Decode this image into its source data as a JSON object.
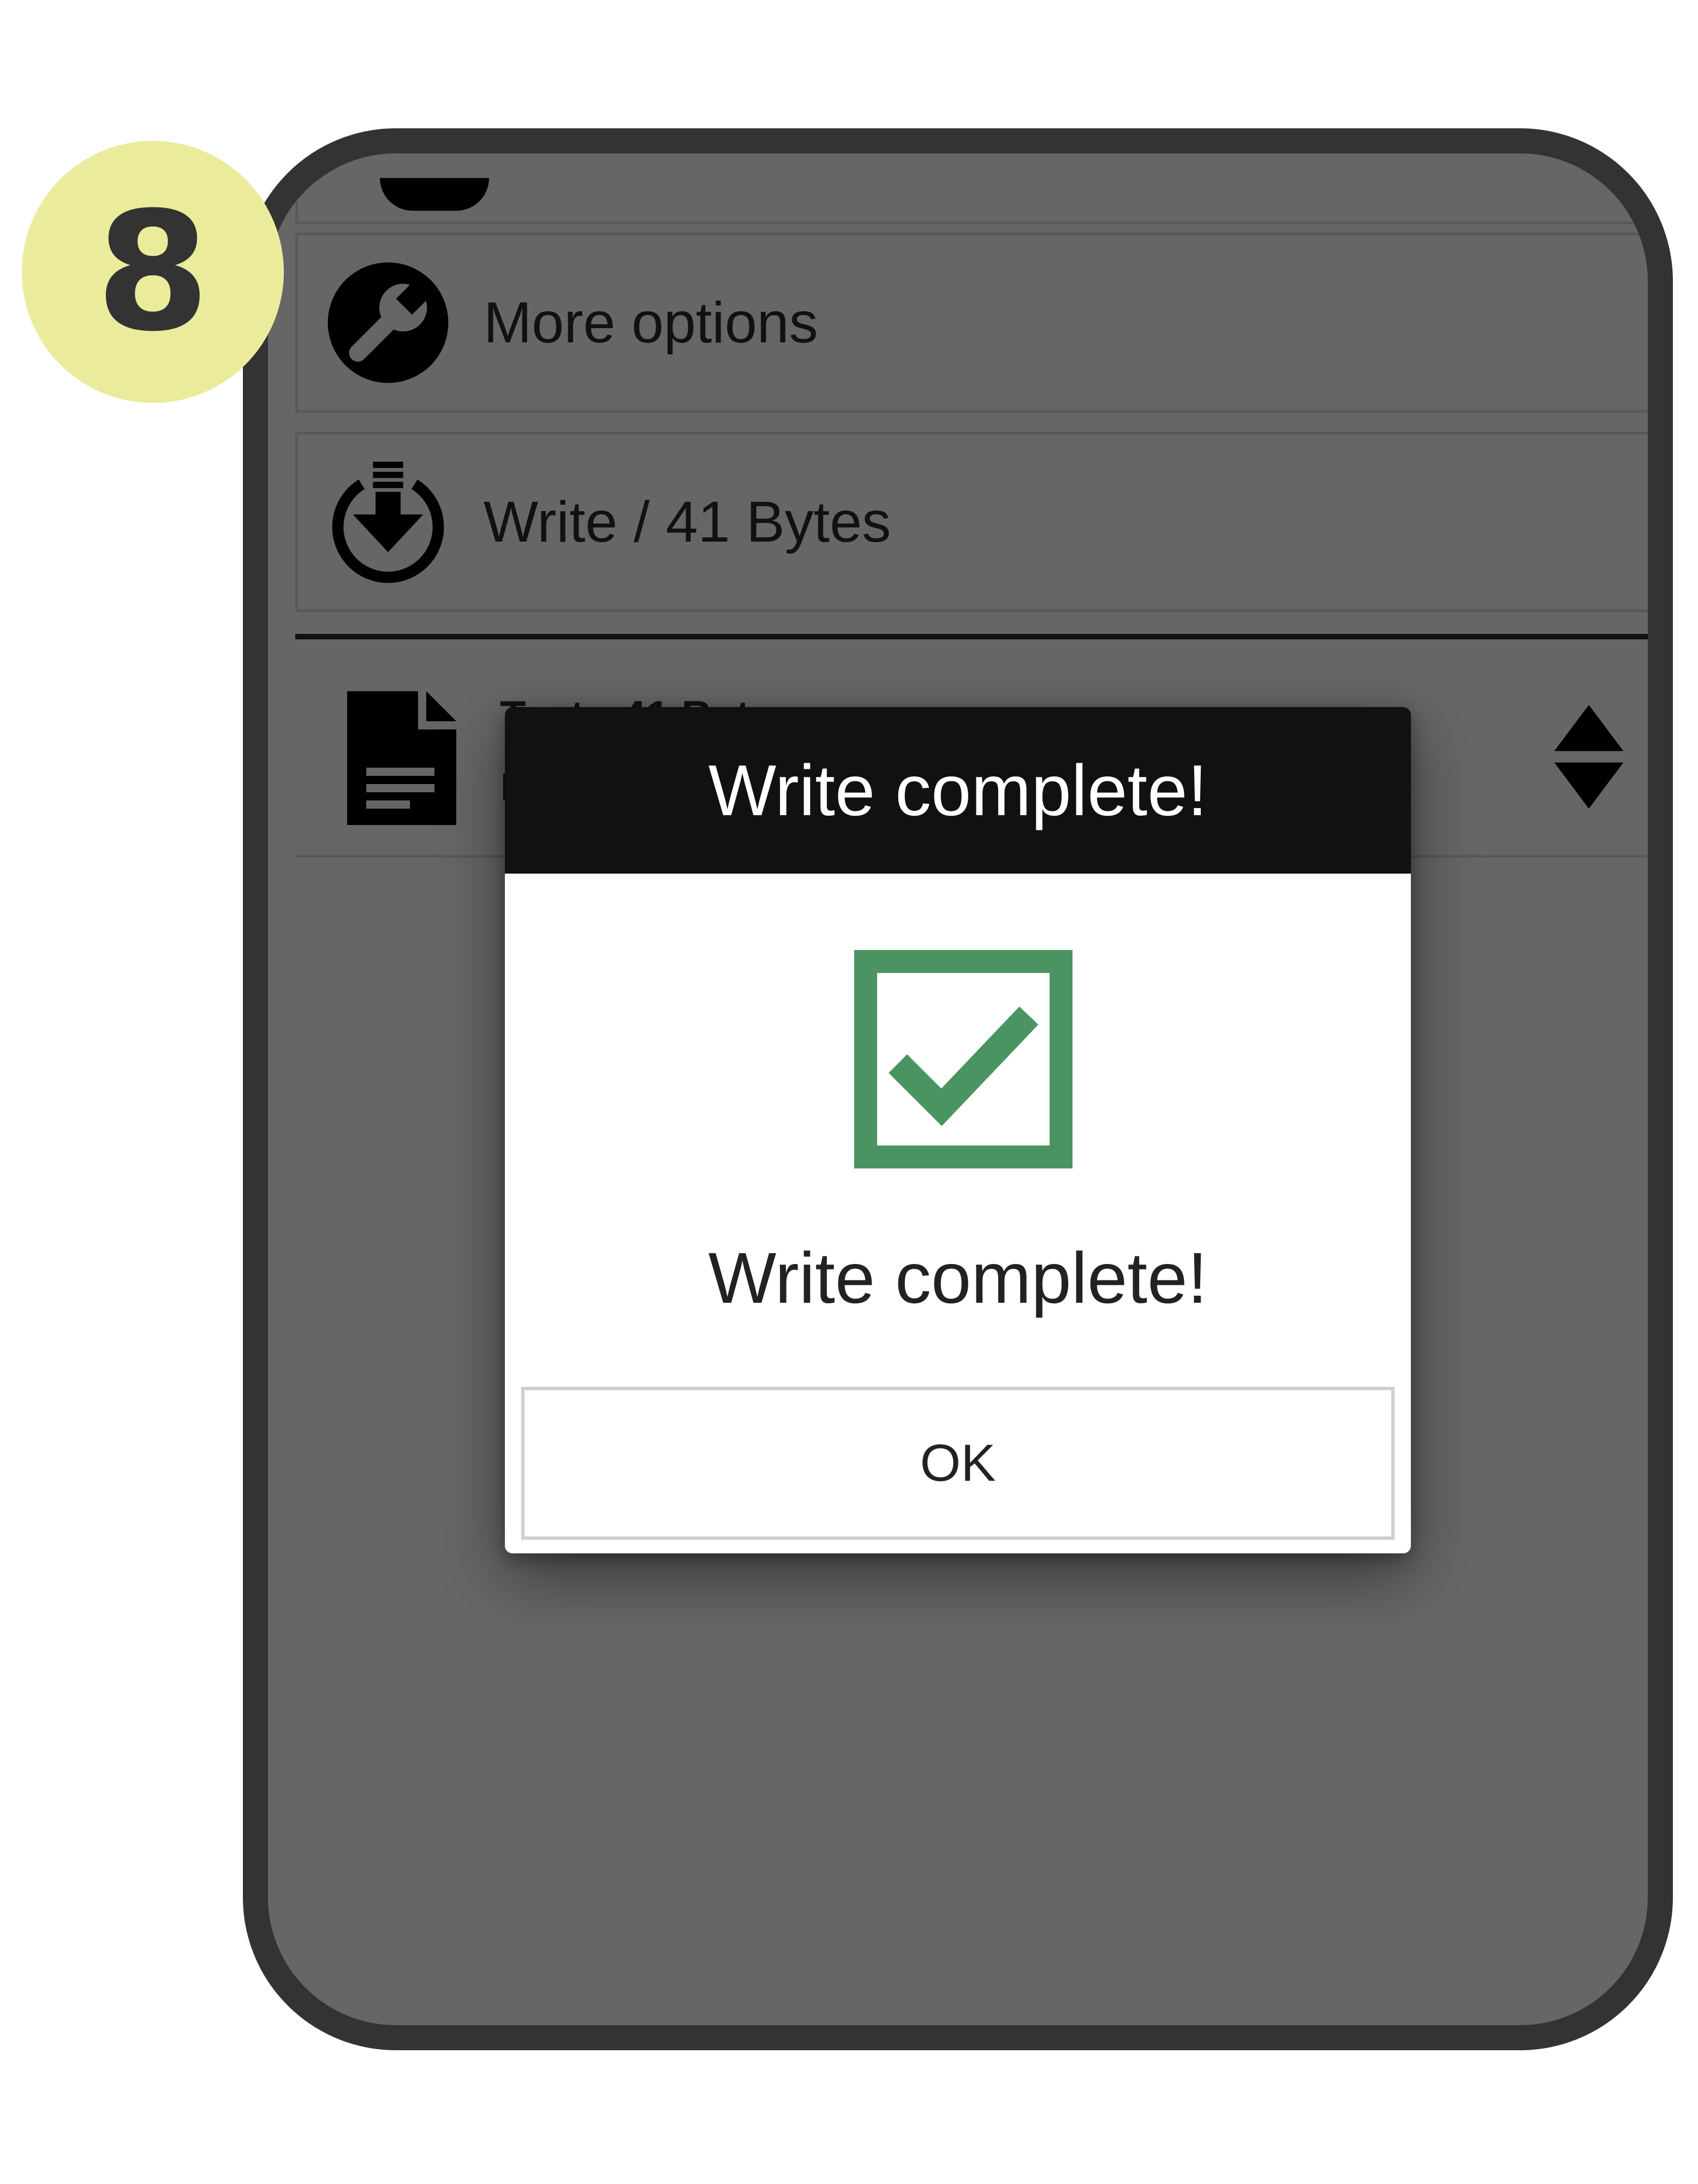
{
  "step": {
    "number": "8"
  },
  "menu": {
    "more_options": {
      "label": "More options",
      "icon": "wrench-icon"
    },
    "write": {
      "label": "Write / 41 Bytes",
      "icon": "download-circle-icon"
    }
  },
  "record": {
    "title": "Text : 41 Bytes",
    "subtitle": "H",
    "icon": "document-icon",
    "sort_icon": "sort-updown-icon"
  },
  "dialog": {
    "title": "Write complete!",
    "message": "Write complete!",
    "ok_label": "OK",
    "icon": "checkbox-checked-icon",
    "accent_color": "#4a9462"
  },
  "colors": {
    "badge": "#ebeb9c",
    "phone_frame": "#333333",
    "overlay_bg": "#666666"
  }
}
